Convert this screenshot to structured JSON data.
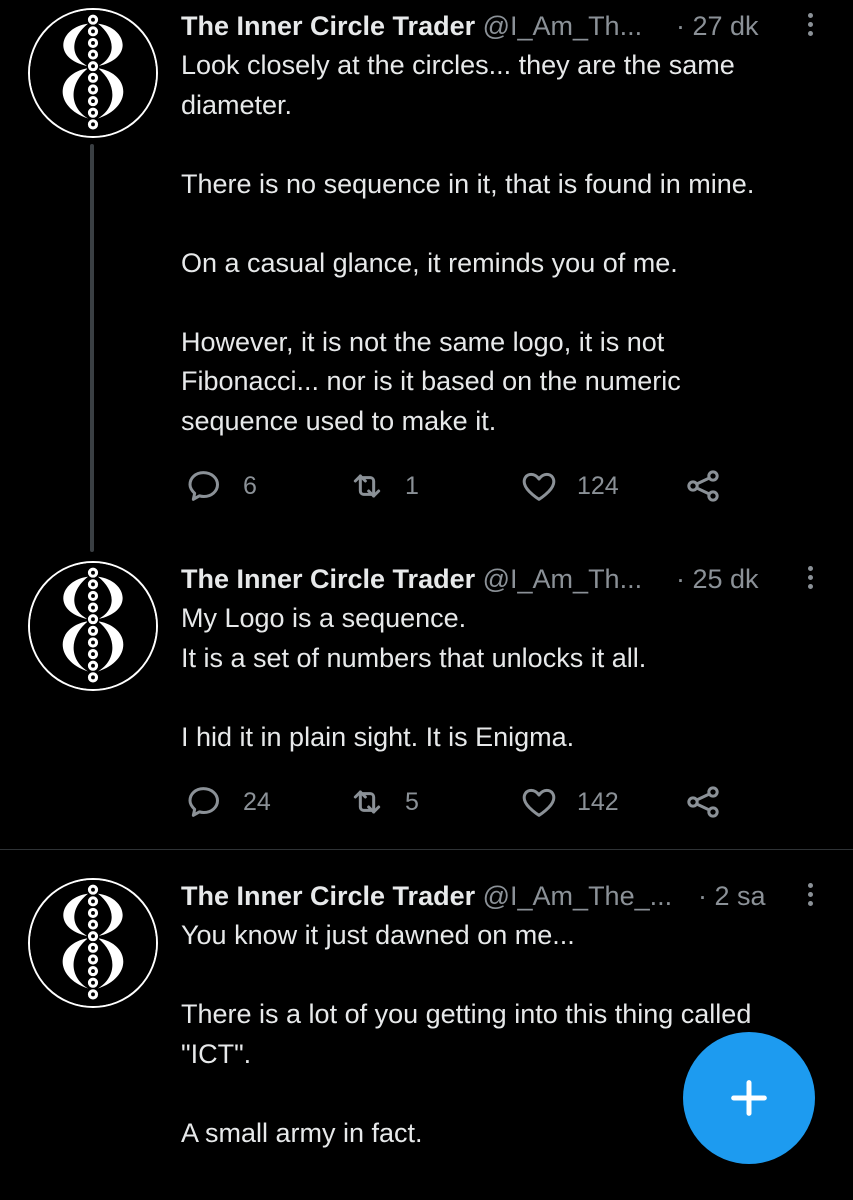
{
  "tweets": [
    {
      "name": "The Inner Circle Trader",
      "handle": "@I_Am_Th...",
      "time": "· 27 dk",
      "lines": [
        "Look closely at the circles... they are the same",
        "diameter.",
        "",
        "There is no sequence in it, that is found in mine.",
        "",
        "On a casual glance, it reminds you of me.",
        "",
        "However, it is not the same logo, it is not",
        "Fibonacci... nor is it based on the numeric",
        "sequence used to make it."
      ],
      "replies": "6",
      "retweets": "1",
      "likes": "124"
    },
    {
      "name": "The Inner Circle Trader",
      "handle": "@I_Am_Th...",
      "time": "· 25 dk",
      "lines": [
        "My Logo is a sequence.",
        "It is a set of numbers that unlocks it all.",
        "",
        "I hid it in plain sight.  It is Enigma."
      ],
      "replies": "24",
      "retweets": "5",
      "likes": "142"
    },
    {
      "name": "The Inner Circle Trader",
      "handle": "@I_Am_The_...",
      "time": "· 2 sa",
      "lines": [
        "You know it just dawned on me...",
        "",
        "There is a lot of you getting into this thing called",
        "\"ICT\".",
        "",
        "A small army in fact."
      ]
    }
  ],
  "icons": {
    "reply": "reply-icon",
    "retweet": "retweet-icon",
    "like": "heart-icon",
    "share": "share-icon",
    "more": "more-vertical-icon",
    "compose": "plus-icon",
    "avatar": "ict-logo-avatar"
  },
  "colors": {
    "background": "#000000",
    "text": "#e7e9ea",
    "muted": "#8b9197",
    "accent": "#1d9bf0",
    "divider": "#2f3336"
  }
}
